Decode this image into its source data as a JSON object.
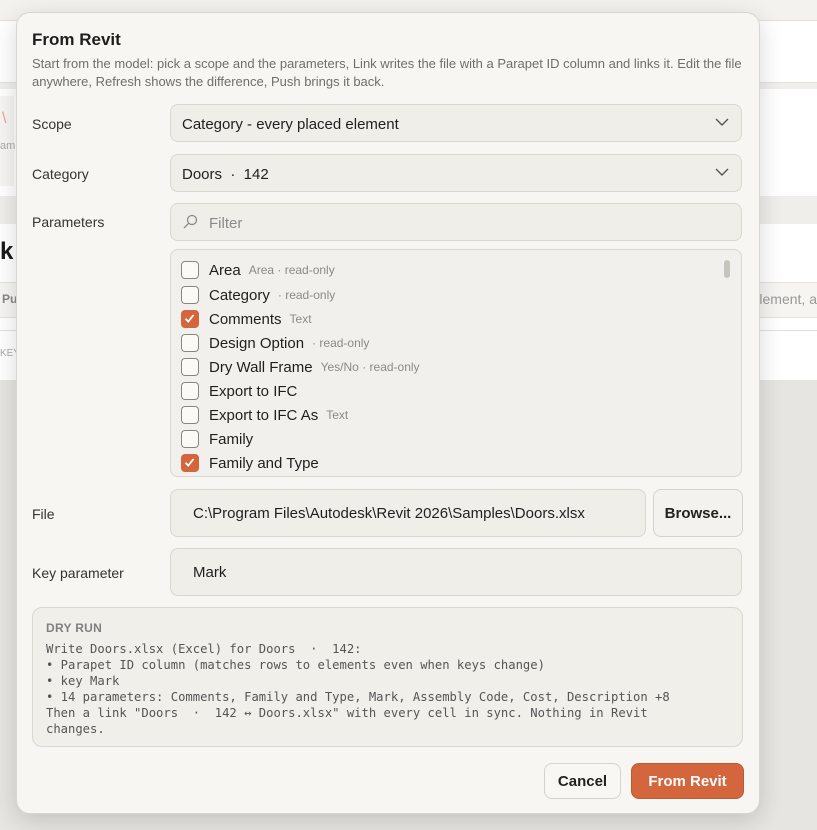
{
  "background": {
    "fragment_k": "k",
    "fragment_pu": "Pu",
    "fragment_element": "lement, a",
    "fragment_key": "KEY",
    "fragment_logo": "am"
  },
  "dialog": {
    "title": "From Revit",
    "description": "Start from the model: pick a scope and the parameters, Link writes the file with a Parapet ID column and links it. Edit the file anywhere, Refresh shows the difference, Push brings it back.",
    "scope": {
      "label": "Scope",
      "value": "Category - every placed element"
    },
    "category": {
      "label": "Category",
      "value": "Doors  ·  142"
    },
    "parameters": {
      "label": "Parameters",
      "filter_placeholder": "Filter",
      "items": [
        {
          "name": "Area",
          "meta": "Area · read-only",
          "checked": false
        },
        {
          "name": "Category",
          "meta": "· read-only",
          "checked": false
        },
        {
          "name": "Comments",
          "meta": "Text",
          "checked": true
        },
        {
          "name": "Design Option",
          "meta": "· read-only",
          "checked": false
        },
        {
          "name": "Dry Wall Frame",
          "meta": "Yes/No · read-only",
          "checked": false
        },
        {
          "name": "Export to IFC",
          "meta": "",
          "checked": false
        },
        {
          "name": "Export to IFC As",
          "meta": "Text",
          "checked": false
        },
        {
          "name": "Family",
          "meta": "",
          "checked": false
        },
        {
          "name": "Family and Type",
          "meta": "",
          "checked": true
        }
      ]
    },
    "file": {
      "label": "File",
      "value": "C:\\Program Files\\Autodesk\\Revit 2026\\Samples\\Doors.xlsx",
      "browse_label": "Browse..."
    },
    "key_parameter": {
      "label": "Key parameter",
      "value": "Mark"
    },
    "dry_run": {
      "heading": "DRY RUN",
      "lines": [
        "Write Doors.xlsx (Excel) for Doors  ·  142:",
        "• Parapet ID column (matches rows to elements even when keys change)",
        "• key Mark",
        "• 14 parameters: Comments, Family and Type, Mark, Assembly Code, Cost, Description +8",
        "Then a link \"Doors  ·  142 ↔ Doors.xlsx\" with every cell in sync. Nothing in Revit",
        "changes."
      ]
    },
    "buttons": {
      "cancel": "Cancel",
      "primary": "From Revit"
    },
    "colors": {
      "accent": "#d4663d",
      "dialog_bg": "#f7f6f2"
    }
  }
}
